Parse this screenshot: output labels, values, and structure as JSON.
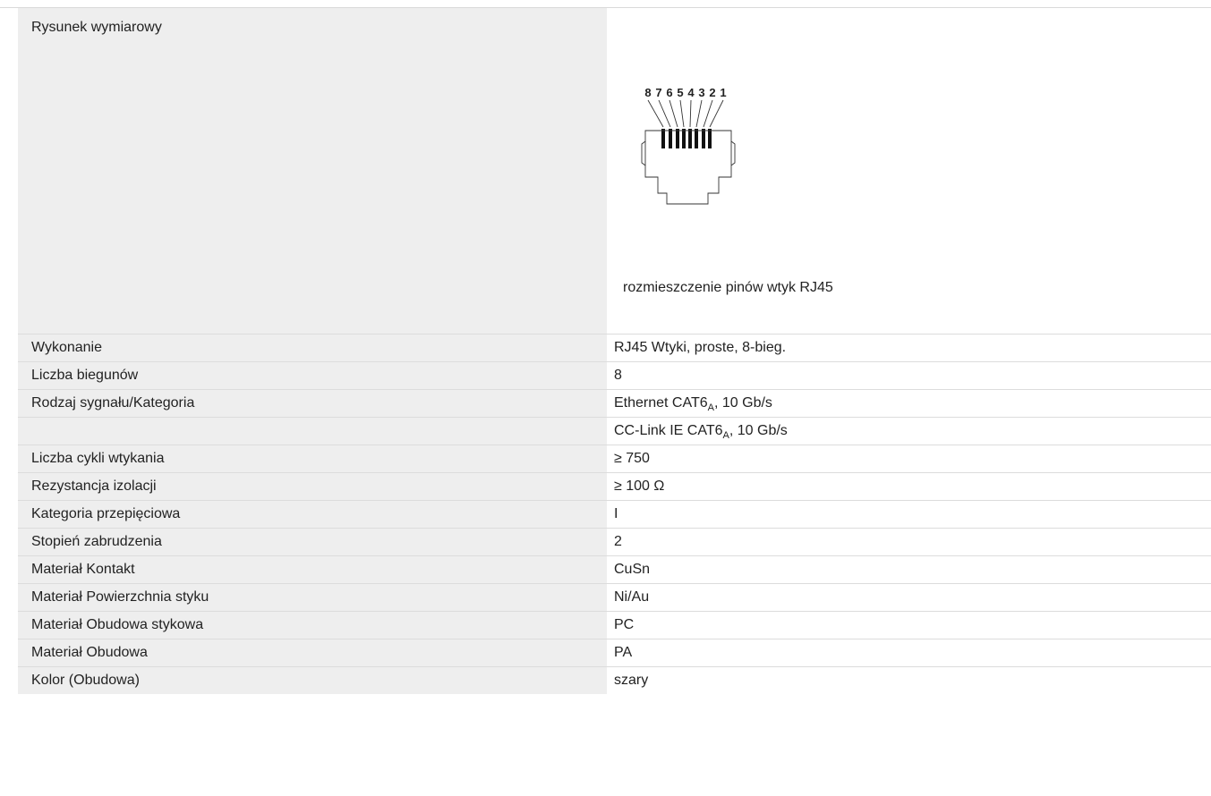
{
  "drawing": {
    "label": "Rysunek wymiarowy",
    "pin_numbers": [
      "8",
      "7",
      "6",
      "5",
      "4",
      "3",
      "2",
      "1"
    ],
    "caption": "rozmieszczenie pinów wtyk RJ45"
  },
  "specs": [
    {
      "label": "Wykonanie",
      "value": "RJ45 Wtyki, proste, 8-bieg."
    },
    {
      "label": "Liczba biegunów",
      "value": "8"
    },
    {
      "label": "Rodzaj sygnału/Kategoria",
      "value_pre": "Ethernet CAT6",
      "value_sub": "A",
      "value_post": ", 10 Gb/s"
    },
    {
      "label": "",
      "value_pre": "CC-Link IE CAT6",
      "value_sub": "A",
      "value_post": ", 10 Gb/s"
    },
    {
      "label": "Liczba cykli wtykania",
      "value": "≥ 750"
    },
    {
      "label": "Rezystancja izolacji",
      "value": "≥ 100 Ω"
    },
    {
      "label": "Kategoria przepięciowa",
      "value": "I"
    },
    {
      "label": "Stopień zabrudzenia",
      "value": "2"
    },
    {
      "label": "Materiał Kontakt",
      "value": "CuSn"
    },
    {
      "label": "Materiał Powierzchnia styku",
      "value": "Ni/Au"
    },
    {
      "label": "Materiał Obudowa stykowa",
      "value": "PC"
    },
    {
      "label": "Materiał Obudowa",
      "value": "PA"
    },
    {
      "label": "Kolor (Obudowa)",
      "value": "szary"
    }
  ]
}
